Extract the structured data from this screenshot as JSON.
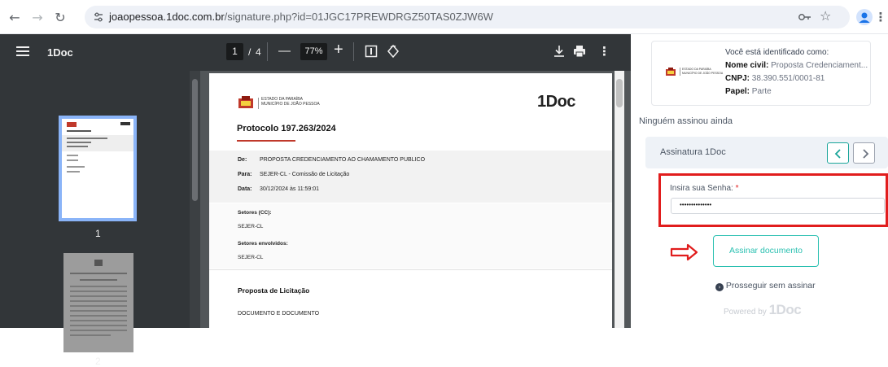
{
  "browser": {
    "url_host": "joaopessoa.1doc.com.br",
    "url_path": "/signature.php?id=01JGC17PREWDRGZ50TAS0ZJW6W"
  },
  "pdf_toolbar": {
    "menu_icon": "hamburger-icon",
    "title": "1Doc",
    "page_current": "1",
    "page_sep": "/",
    "page_total": "4",
    "minus": "—",
    "zoom": "77%",
    "plus": "+"
  },
  "thumbnails": {
    "page1_label": "1",
    "page2_label": "2"
  },
  "document": {
    "org_line1": "ESTADO DA PARAÍBA",
    "org_line2": "MUNICÍPIO DE JOÃO PESSOA",
    "brand": "1Doc",
    "protocol": "Protocolo 197.263/2024",
    "de_label": "De:",
    "de_value": "PROPOSTA CREDENCIAMENTO AO CHAMAMENTO PUBLICO",
    "para_label": "Para:",
    "para_value": "SEJER-CL - Comissão de Licitação",
    "data_label": "Data:",
    "data_value": "30/12/2024 às 11:59:01",
    "setores_label": "Setores (CC):",
    "setores_value": "SEJER-CL",
    "envolvidos_label": "Setores envolvidos:",
    "envolvidos_value": "SEJER-CL",
    "section_title": "Proposta de Licitação",
    "body_text": "DOCUMENTO E DOCUMENTO"
  },
  "panel": {
    "identified_title": "Você está identificado como:",
    "nome_label": "Nome civil:",
    "nome_value": "Proposta Credenciament...",
    "cnpj_label": "CNPJ:",
    "cnpj_value": "38.390.551/0001-81",
    "papel_label": "Papel:",
    "papel_value": "Parte",
    "nobody_signed": "Ninguém assinou ainda",
    "signature_label": "Assinatura 1Doc",
    "password_label": "Insira sua Senha:",
    "password_required": "*",
    "password_value": "••••••••••••••",
    "sign_button": "Assinar documento",
    "skip_link": "Prosseguir sem assinar",
    "powered_by": "Powered by",
    "powered_brand": "1Doc"
  },
  "colors": {
    "accent": "#1aa59a",
    "highlight_red": "#e11d1d"
  }
}
